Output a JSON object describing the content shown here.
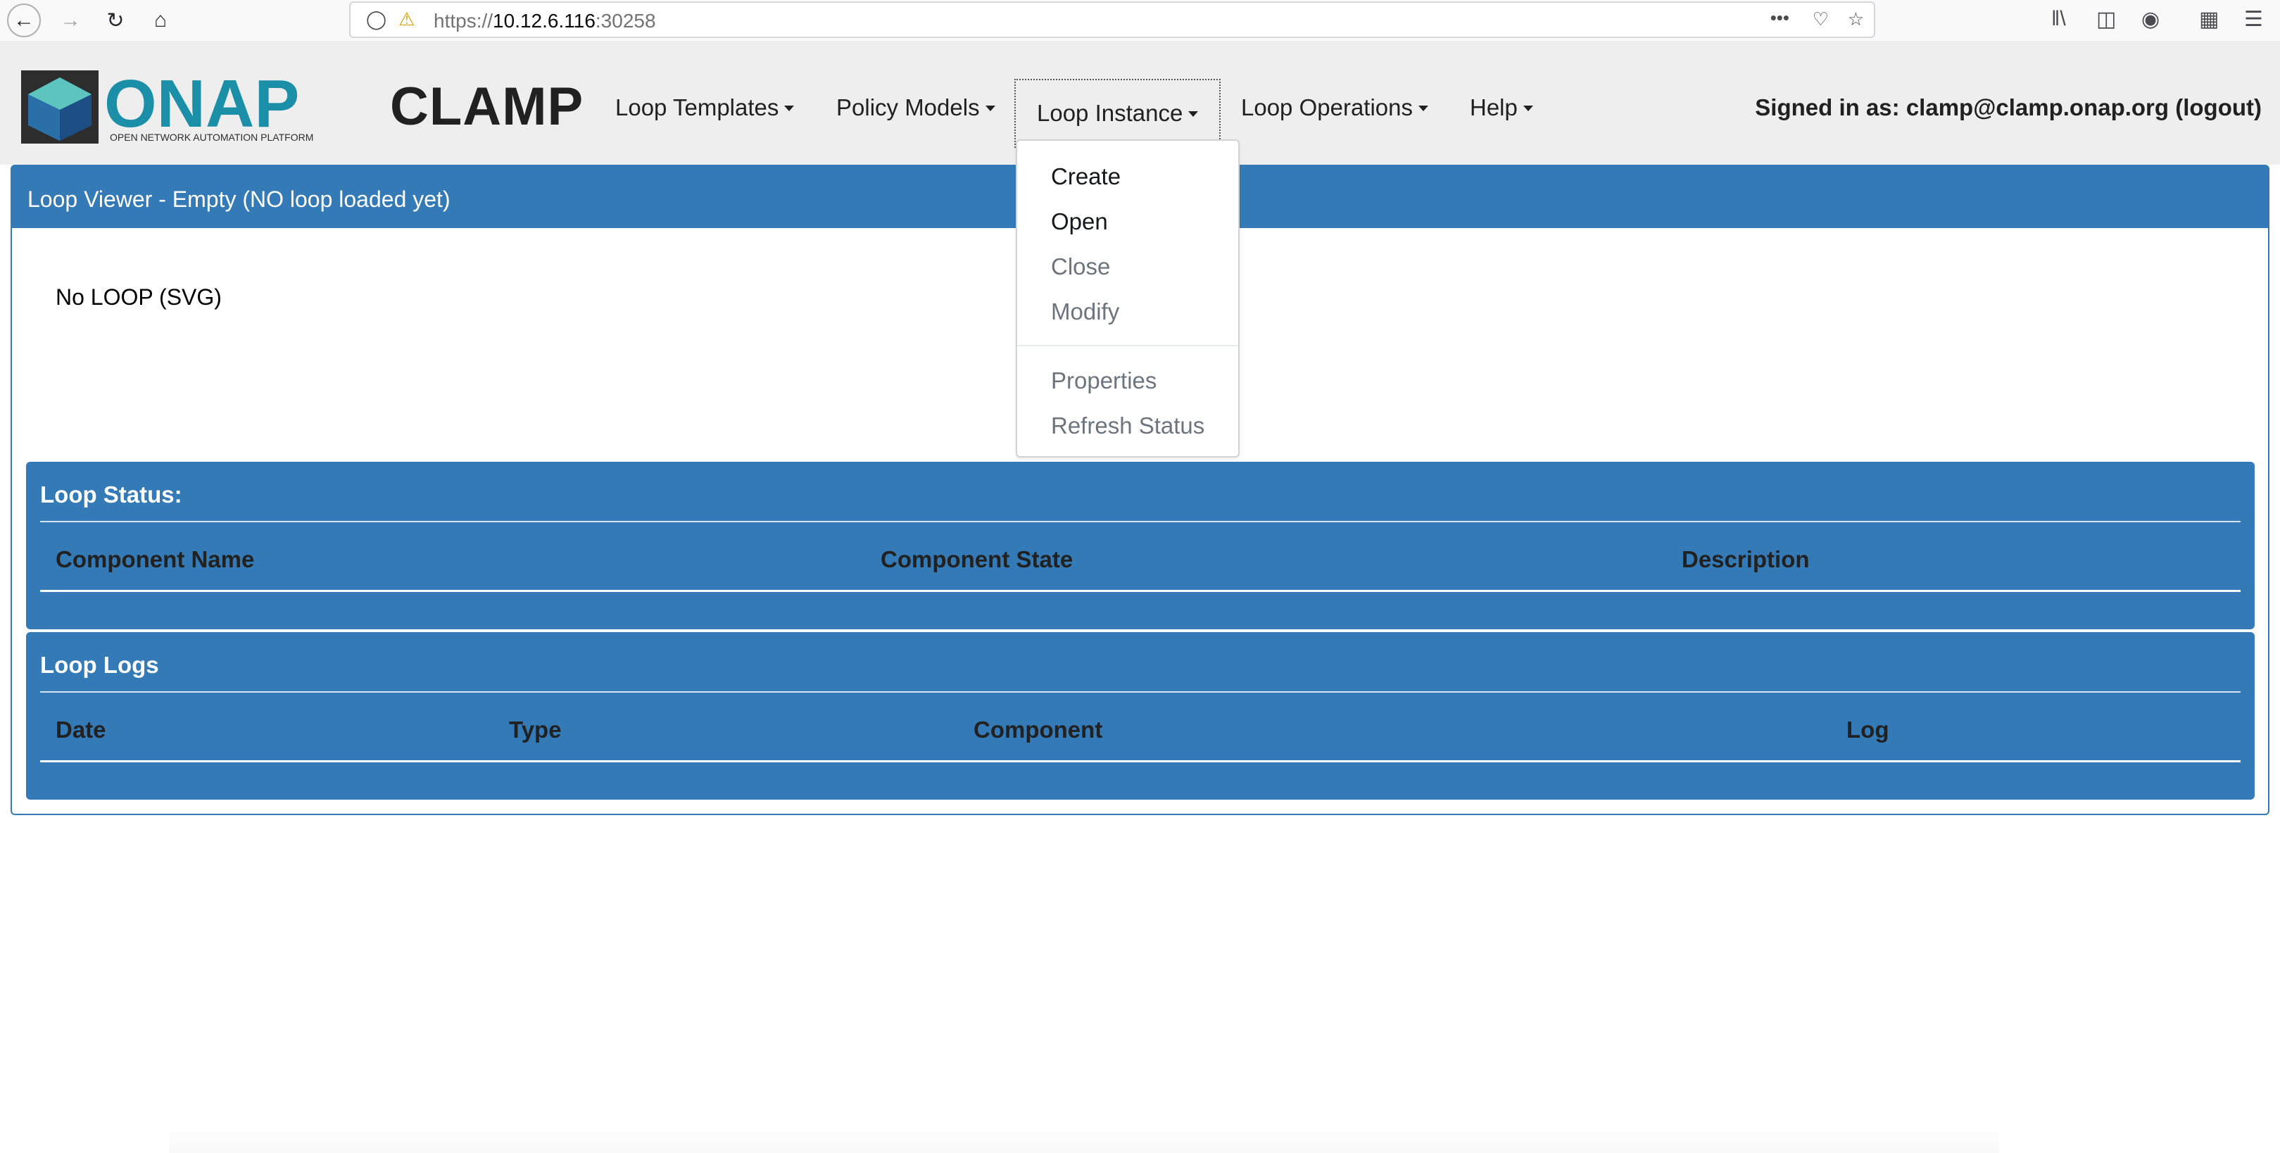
{
  "browser": {
    "url_prefix": "https://",
    "url_host": "10.12.6.116",
    "url_port": ":30258",
    "more_icon": "•••"
  },
  "app": {
    "logo_text": "ONAP",
    "logo_subtitle": "OPEN NETWORK AUTOMATION PLATFORM",
    "title": "CLAMP",
    "nav": {
      "loop_templates": "Loop Templates",
      "policy_models": "Policy Models",
      "loop_instance": "Loop Instance",
      "loop_operations": "Loop Operations",
      "help": "Help"
    },
    "signed_in": "Signed in as: clamp@clamp.onap.org (logout)"
  },
  "dropdown": {
    "items": [
      {
        "label": "Create",
        "enabled": true
      },
      {
        "label": "Open",
        "enabled": true
      },
      {
        "label": "Close",
        "enabled": false
      },
      {
        "label": "Modify",
        "enabled": false
      },
      {
        "label": "Properties",
        "enabled": false
      },
      {
        "label": "Refresh Status",
        "enabled": false
      }
    ]
  },
  "viewer": {
    "header": "Loop Viewer - Empty (NO loop loaded yet)",
    "placeholder": "No LOOP (SVG)"
  },
  "loop_status": {
    "title": "Loop Status:",
    "columns": [
      "Component Name",
      "Component State",
      "Description"
    ]
  },
  "loop_logs": {
    "title": "Loop Logs",
    "columns": [
      "Date",
      "Type",
      "Component",
      "Log"
    ]
  },
  "colors": {
    "primary": "#337ab7",
    "navbar_bg": "#eeeeee",
    "logo_teal": "#1c8fa8"
  }
}
